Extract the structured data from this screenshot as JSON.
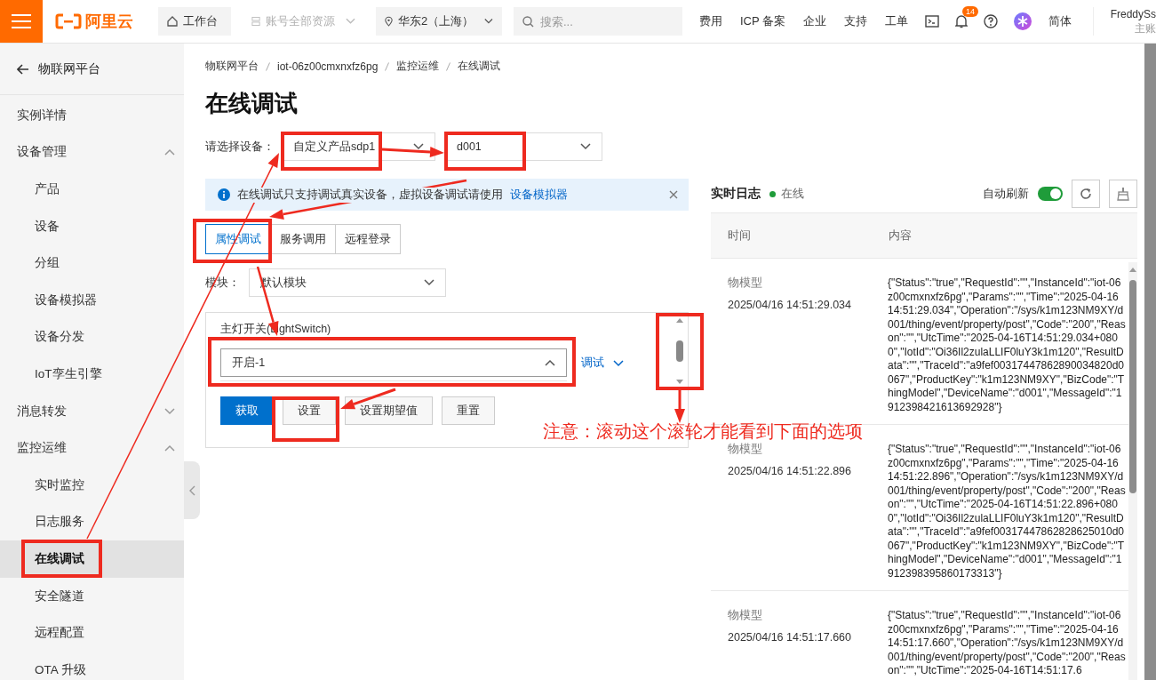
{
  "topbar": {
    "logo": "阿里云",
    "workbench": "工作台",
    "resources": {
      "label": "账号全部资源",
      "disabled": true
    },
    "region": "华东2（上海）",
    "search": {
      "placeholder": "搜索..."
    },
    "links": [
      "费用",
      "ICP 备案",
      "企业",
      "支持",
      "工单"
    ],
    "notification_count": "14",
    "language": "简体",
    "user": {
      "name": "FreddySs",
      "role": "主账"
    }
  },
  "sidebar": {
    "back": "物联网平台",
    "items": [
      {
        "label": "实例详情",
        "selected": false
      },
      {
        "label": "设备管理",
        "selected": false,
        "expanded": true,
        "children": [
          {
            "label": "产品",
            "selected": false
          },
          {
            "label": "设备",
            "selected": false
          },
          {
            "label": "分组",
            "selected": false
          },
          {
            "label": "设备模拟器",
            "selected": false
          },
          {
            "label": "设备分发",
            "selected": false
          },
          {
            "label": "IoT孪生引擎",
            "selected": false
          }
        ]
      },
      {
        "label": "消息转发",
        "selected": false,
        "expanded": false
      },
      {
        "label": "监控运维",
        "selected": false,
        "expanded": true,
        "children": [
          {
            "label": "实时监控",
            "selected": false
          },
          {
            "label": "日志服务",
            "selected": false
          },
          {
            "label": "在线调试",
            "selected": true
          },
          {
            "label": "安全隧道",
            "selected": false
          },
          {
            "label": "远程配置",
            "selected": false
          },
          {
            "label": "OTA 升级",
            "selected": false
          }
        ]
      }
    ]
  },
  "breadcrumb": [
    "物联网平台",
    "iot-06z00cmxnxfz6pg",
    "监控运维",
    "在线调试"
  ],
  "title": "在线调试",
  "device": {
    "label": "请选择设备：",
    "product": "自定义产品sdp1",
    "device_name": "d001"
  },
  "alert": {
    "text": "在线调试只支持调试真实设备，虚拟设备调试请使用",
    "link": "设备模拟器"
  },
  "tabs": [
    {
      "label": "属性调试",
      "selected": true
    },
    {
      "label": "服务调用",
      "selected": false
    },
    {
      "label": "远程登录",
      "selected": false
    }
  ],
  "module": {
    "label": "模块：",
    "value": "默认模块"
  },
  "property": {
    "label": "主灯开关(LightSwitch)",
    "value": "开启-1",
    "expanded": true,
    "mode": "调试"
  },
  "buttons": [
    {
      "label": "获取",
      "primary": true
    },
    {
      "label": "设置",
      "primary": false
    },
    {
      "label": "设置期望值",
      "primary": false
    },
    {
      "label": "重置",
      "primary": false
    }
  ],
  "log": {
    "title": "实时日志",
    "status": {
      "label": "在线",
      "online": true
    },
    "auto_refresh": {
      "label": "自动刷新",
      "on": true
    },
    "columns": [
      "时间",
      "内容"
    ],
    "rows": [
      {
        "type": "物模型",
        "time": "2025/04/16 14:51:29.034",
        "content": "{\"Status\":\"true\",\"RequestId\":\"\",\"InstanceId\":\"iot-06z00cmxnxfz6pg\",\"Params\":\"\",\"Time\":\"2025-04-16 14:51:29.034\",\"Operation\":\"/sys/k1m123NM9XY/d001/thing/event/property/post\",\"Code\":\"200\",\"Reason\":\"\",\"UtcTime\":\"2025-04-16T14:51:29.034+0800\",\"IotId\":\"Oi36Il2zulaLLIF0luY3k1m120\",\"ResultData\":\"\",\"TraceId\":\"a9fef00317447862890034820d0067\",\"ProductKey\":\"k1m123NM9XY\",\"BizCode\":\"ThingModel\",\"DeviceName\":\"d001\",\"MessageId\":\"1912398421613692928\"}"
      },
      {
        "type": "物模型",
        "time": "2025/04/16 14:51:22.896",
        "content": "{\"Status\":\"true\",\"RequestId\":\"\",\"InstanceId\":\"iot-06z00cmxnxfz6pg\",\"Params\":\"\",\"Time\":\"2025-04-16 14:51:22.896\",\"Operation\":\"/sys/k1m123NM9XY/d001/thing/event/property/post\",\"Code\":\"200\",\"Reason\":\"\",\"UtcTime\":\"2025-04-16T14:51:22.896+0800\",\"IotId\":\"Oi36Il2zulaLLIF0luY3k1m120\",\"ResultData\":\"\",\"TraceId\":\"a9fef00317447862828625010d0067\",\"ProductKey\":\"k1m123NM9XY\",\"BizCode\":\"ThingModel\",\"DeviceName\":\"d001\",\"MessageId\":\"1912398395860173313\"}"
      },
      {
        "type": "物模型",
        "time": "2025/04/16 14:51:17.660",
        "content": "{\"Status\":\"true\",\"RequestId\":\"\",\"InstanceId\":\"iot-06z00cmxnxfz6pg\",\"Params\":\"\",\"Time\":\"2025-04-16 14:51:17.660\",\"Operation\":\"/sys/k1m123NM9XY/d001/thing/event/property/post\",\"Code\":\"200\",\"Reason\":\"\",\"UtcTime\":\"2025-04-16T14:51:17.6"
      }
    ]
  },
  "annotation": {
    "note": "注意：滚动这个滚轮才能看到下面的选项"
  }
}
